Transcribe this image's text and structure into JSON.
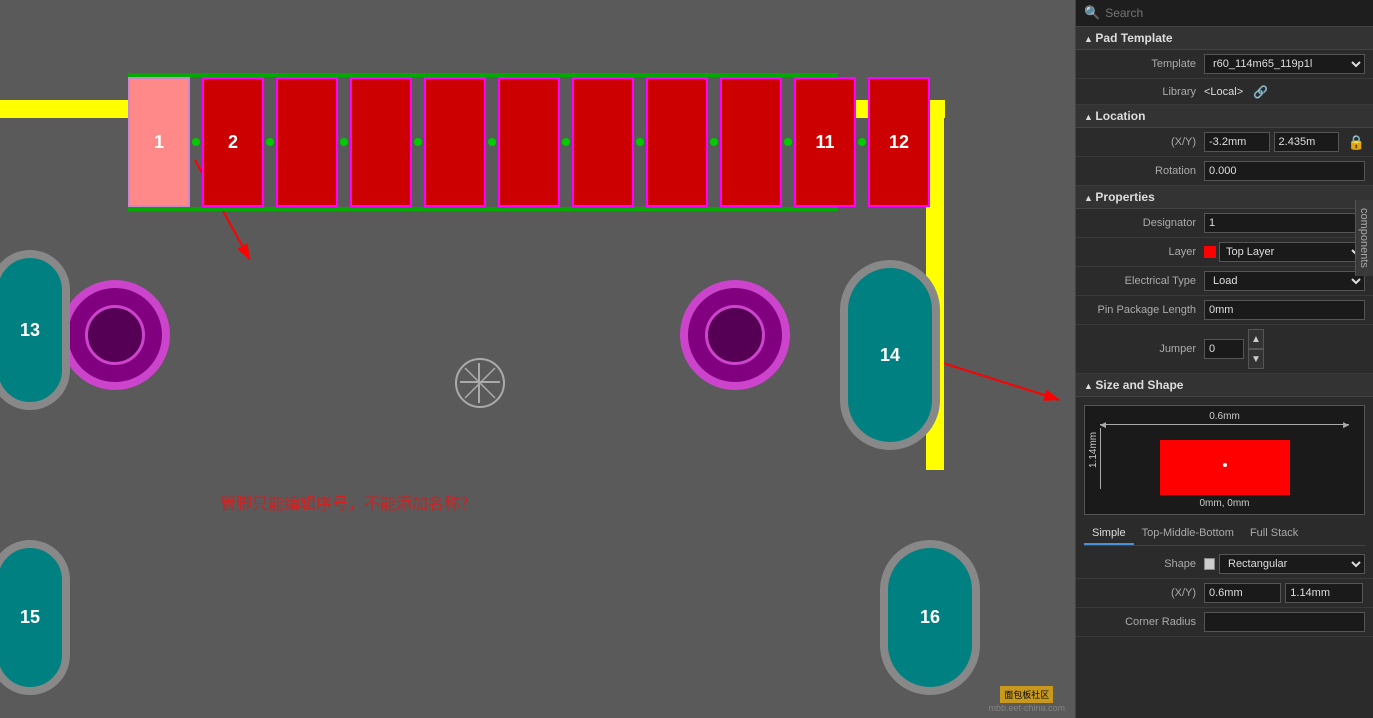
{
  "search": {
    "placeholder": "Search"
  },
  "panel": {
    "pad_template_label": "Pad Template",
    "template_value": "r60_114m65_119p1l",
    "library_label": "Library",
    "library_value": "<Local>",
    "location_label": "Location",
    "xy_label": "(X/Y)",
    "x_value": "-3.2mm",
    "y_value": "2.435m",
    "rotation_label": "Rotation",
    "rotation_value": "0.000",
    "properties_label": "Properties",
    "designator_label": "Designator",
    "designator_value": "1",
    "layer_label": "Layer",
    "layer_value": "Top Layer",
    "electrical_type_label": "Electrical Type",
    "electrical_type_value": "Load",
    "pin_package_length_label": "Pin Package Length",
    "pin_package_length_value": "0mm",
    "jumper_label": "Jumper",
    "jumper_value": "0",
    "size_shape_label": "Size and Shape",
    "shape_width": "0.6mm",
    "shape_height": "1.14mm",
    "shape_dim_bottom": "0mm, 0mm",
    "tab_simple": "Simple",
    "tab_top_middle_bottom": "Top-Middle-Bottom",
    "tab_full_stack": "Full Stack",
    "shape_label": "Shape",
    "shape_value": "Rectangular",
    "xy_size_label": "(X/Y)",
    "xy_size_x": "0.6mm",
    "xy_size_y": "1.14mm",
    "corner_radius_label": "Corner Radius"
  },
  "canvas": {
    "pad_numbers": [
      "1",
      "2",
      "11",
      "12"
    ],
    "pin13_label": "13",
    "pin14_label": "14",
    "pin15_label": "15",
    "pin16_label": "16",
    "chinese_text": "管脚只能编辑序号，不能添加名称？"
  },
  "components_tab": "components"
}
